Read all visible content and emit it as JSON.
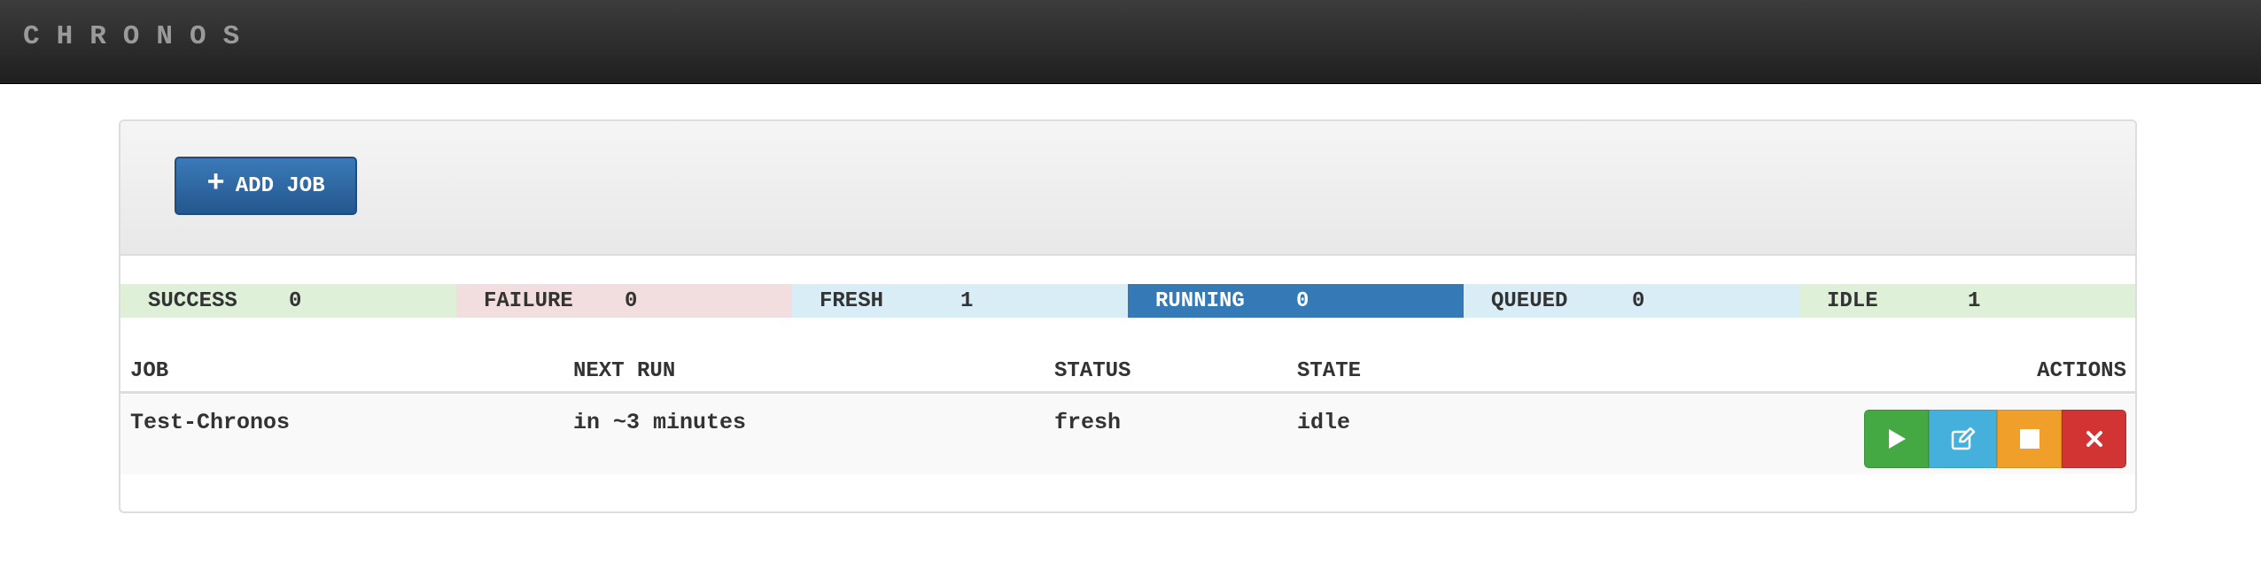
{
  "navbar": {
    "brand": "CHRONOS"
  },
  "toolbar": {
    "add_job_label": "ADD JOB",
    "add_icon": "plus-icon"
  },
  "stats": [
    {
      "label": "SUCCESS",
      "count": "0",
      "color": "#dff0d8"
    },
    {
      "label": "FAILURE",
      "count": "0",
      "color": "#f2dede"
    },
    {
      "label": "FRESH",
      "count": "1",
      "color": "#d9edf7"
    },
    {
      "label": "RUNNING",
      "count": "0",
      "color": "#337ab7"
    },
    {
      "label": "QUEUED",
      "count": "0",
      "color": "#d9edf7"
    },
    {
      "label": "IDLE",
      "count": "1",
      "color": "#dff0d8"
    }
  ],
  "table": {
    "headers": {
      "job": "JOB",
      "next_run": "NEXT RUN",
      "status": "STATUS",
      "state": "STATE",
      "actions": "ACTIONS"
    },
    "rows": [
      {
        "job": "Test-Chronos",
        "next_run": "in ~3 minutes",
        "status": "fresh",
        "state": "idle"
      }
    ]
  },
  "actions": {
    "run_icon": "play-icon",
    "edit_icon": "edit-icon",
    "stop_icon": "stop-icon",
    "delete_icon": "close-icon"
  }
}
